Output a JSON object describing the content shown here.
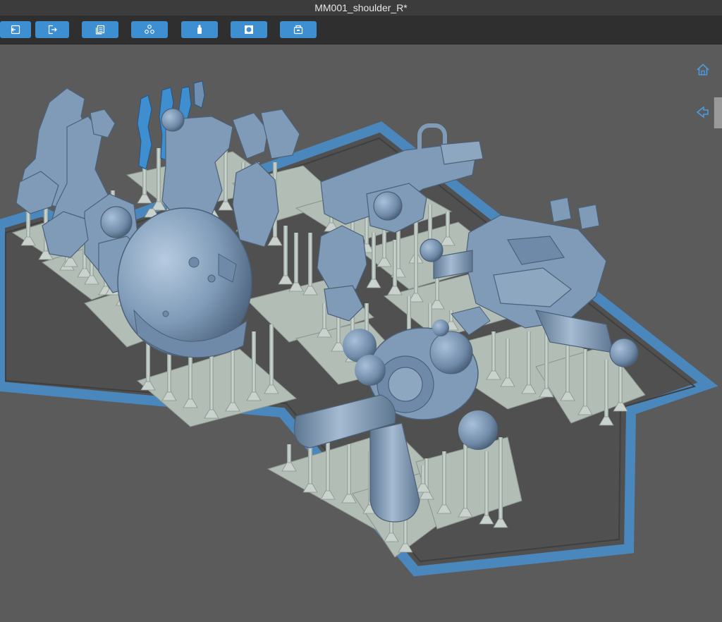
{
  "window": {
    "title": "MM001_shoulder_R*"
  },
  "toolbar": {
    "buttons": [
      {
        "name": "import-button",
        "icon": "import-icon"
      },
      {
        "name": "export-button",
        "icon": "export-icon"
      },
      {
        "name": "copy-button",
        "icon": "copy-icon"
      },
      {
        "name": "arrange-button",
        "icon": "arrange-icon"
      },
      {
        "name": "support-button",
        "icon": "support-icon"
      },
      {
        "name": "hollow-button",
        "icon": "hollow-icon"
      },
      {
        "name": "print-button",
        "icon": "print-icon"
      }
    ]
  },
  "viewport": {
    "side_controls": [
      {
        "name": "home-view-button",
        "icon": "home-icon"
      },
      {
        "name": "view-cube-button",
        "icon": "view-cube-icon"
      }
    ]
  },
  "colors": {
    "build_plate_frame": "#4a87bd",
    "model": "#7f9bb8",
    "model_selected": "#3f8fd0",
    "supports": "#b8c3bd",
    "raft": "#b2bdb6",
    "toolbar_button": "#3d8fd1"
  }
}
